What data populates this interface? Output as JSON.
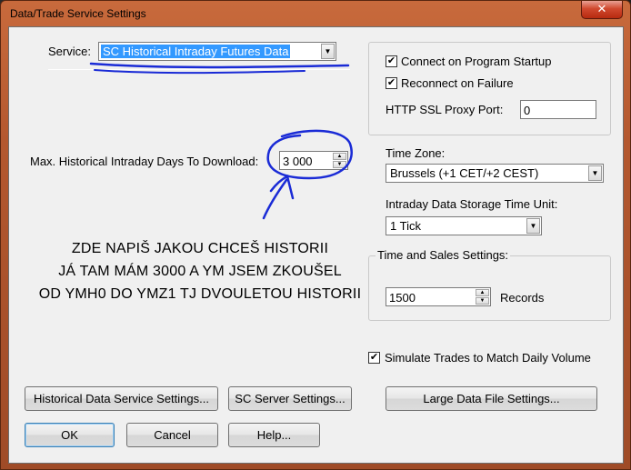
{
  "window": {
    "title": "Data/Trade Service Settings",
    "close_glyph": "✕"
  },
  "service": {
    "label": "Service:",
    "value": "SC Historical Intraday Futures Data"
  },
  "days": {
    "label": "Max. Historical Intraday Days To Download:",
    "value": "3 000"
  },
  "connection": {
    "connect_on_startup": {
      "label": "Connect on Program Startup",
      "checked": true
    },
    "reconnect_on_failure": {
      "label": "Reconnect on Failure",
      "checked": true
    },
    "proxy_port": {
      "label": "HTTP SSL Proxy Port:",
      "value": "0"
    }
  },
  "time_zone": {
    "label": "Time Zone:",
    "value": "Brussels (+1 CET/+2 CEST)"
  },
  "storage_unit": {
    "label": "Intraday Data Storage Time Unit:",
    "value": "1 Tick"
  },
  "time_and_sales": {
    "title": "Time and Sales Settings:",
    "value": "1500",
    "unit": "Records"
  },
  "simulate_trades": {
    "label": "Simulate Trades to Match Daily Volume",
    "checked": true
  },
  "annotation": {
    "lines": [
      "ZDE NAPIŠ JAKOU CHCEŠ HISTORII",
      "JÁ TAM MÁM 3000 A YM JSEM ZKOUŠEL",
      "OD YMH0 DO YMZ1 TJ DVOULETOU HISTORII"
    ],
    "ink_color": "#1a2bd6"
  },
  "buttons": {
    "historical": "Historical Data Service Settings...",
    "sc_server": "SC Server Settings...",
    "large_file": "Large Data File Settings...",
    "ok": "OK",
    "cancel": "Cancel",
    "help": "Help..."
  },
  "glyphs": {
    "check": "✔",
    "dropdown": "▼",
    "spin_up": "▲",
    "spin_down": "▼"
  }
}
